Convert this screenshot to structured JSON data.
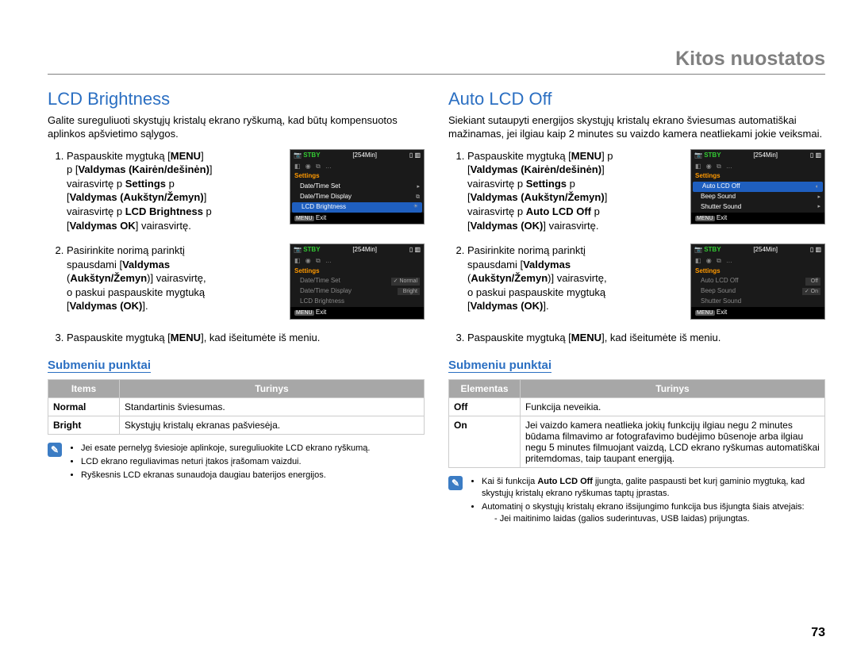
{
  "header": "Kitos nuostatos",
  "pagenum": "73",
  "left": {
    "title": "LCD Brightness",
    "intro": "Galite sureguliuoti skystųjų kristalų ekrano ryškumą, kad būtų kompensuotos aplinkos apšvietimo sąlygos.",
    "step1_pre": "Paspauskite mygtuką [",
    "menu_label": "MENU",
    "step1_rest": "]  p [Valdymas (Kairėn/dešinėn)]  vairasvirtę  p Settings  p [Valdymas (Aukštyn/Žemyn)]  vairasvirtę  p LCD Brightness  p [Valdymas OK] vairasvirtę.",
    "step2": "Pasirinkite norimą parinktį spausdami [Valdymas (Aukštyn/Žemyn)] vairasvirtę, o paskui paspauskite mygtuką [Valdymas (OK)].",
    "step3_a": "Paspauskite mygtuką [",
    "step3_b": "], kad išeitumėte iš meniu.",
    "sub": "Submeniu punktai",
    "tbl": {
      "h1": "Items",
      "h2": "Turinys",
      "rows": [
        {
          "k": "Normal",
          "v": "Standartinis šviesumas."
        },
        {
          "k": "Bright",
          "v": "Skystųjų kristalų ekranas pašviesėja."
        }
      ]
    },
    "notes": [
      "Jei esate pernelyg šviesioje aplinkoje, sureguliuokite LCD ekrano ryškumą.",
      "LCD ekrano reguliavimas neturi įtakos įrašomam vaizdui.",
      "Ryškesnis LCD ekranas sunaudoja daugiau baterijos energijos."
    ],
    "shot1": {
      "stby": "STBY",
      "time": "[254Min]",
      "settings": "Settings",
      "rows": [
        "Date/Time Set",
        "Date/Time Display",
        "LCD Brightness"
      ],
      "exit": "Exit",
      "menu": "MENU"
    },
    "shot2": {
      "stby": "STBY",
      "time": "[254Min]",
      "settings": "Settings",
      "rows": [
        "Date/Time Set",
        "Date/Time Display",
        "LCD Brightness"
      ],
      "opts": [
        "Normal",
        "Bright"
      ],
      "exit": "Exit",
      "menu": "MENU"
    }
  },
  "right": {
    "title": "Auto LCD Off",
    "intro": "Siekiant sutaupyti energijos skystųjų kristalų ekrano šviesumas automatiškai mažinamas, jei ilgiau kaip 2 minutes su vaizdo kamera neatliekami jokie veiksmai.",
    "step1": "Paspauskite mygtuką [MENU]  p [Valdymas (Kairėn/dešinėn)]  vairasvirtę  p Settings  p [Valdymas (Aukštyn/Žemyn)]  vairasvirtę  p Auto LCD Off  p [Valdymas (OK)] vairasvirtę.",
    "step2": "Pasirinkite norimą parinktį spausdami [Valdymas (Aukštyn/Žemyn)] vairasvirtę, o paskui paspauskite mygtuką [Valdymas (OK)].",
    "step3_a": "Paspauskite mygtuką [",
    "step3_b": "], kad išeitumėte iš meniu.",
    "menu_label": "MENU",
    "sub": "Submeniu punktai",
    "tbl": {
      "h1": "Elementas",
      "h2": "Turinys",
      "rows": [
        {
          "k": "Off",
          "v": "Funkcija neveikia."
        },
        {
          "k": "On",
          "v": "Jei vaizdo kamera neatlieka jokių funkcijų ilgiau negu 2 minutes būdama filmavimo ar fotografavimo budėjimo būsenoje arba ilgiau negu 5 minutes filmuojant vaizdą, LCD ekrano ryškumas automatiškai pritemdomas, taip taupant energiją."
        }
      ]
    },
    "notes": [
      "Kai ši funkcija Auto LCD Off įjungta, galite paspausti bet kurį gaminio mygtuką, kad skystųjų kristalų ekrano ryškumas taptų įprastas.",
      "Automatinį o skystųjų kristalų ekrano išsijungimo funkcija bus išjungta šiais atvejais:"
    ],
    "subnote": "- Jei maitinimo laidas (galios suderintuvas, USB laidas) prijungtas.",
    "note_bold": "Auto LCD Off",
    "shot1": {
      "stby": "STBY",
      "time": "[254Min]",
      "settings": "Settings",
      "rows": [
        "Auto LCD Off",
        "Beep Sound",
        "Shutter Sound"
      ],
      "exit": "Exit",
      "menu": "MENU"
    },
    "shot2": {
      "stby": "STBY",
      "time": "[254Min]",
      "settings": "Settings",
      "rows": [
        "Auto LCD Off",
        "Beep Sound",
        "Shutter Sound"
      ],
      "opts": [
        "Off",
        "On"
      ],
      "exit": "Exit",
      "menu": "MENU"
    }
  }
}
